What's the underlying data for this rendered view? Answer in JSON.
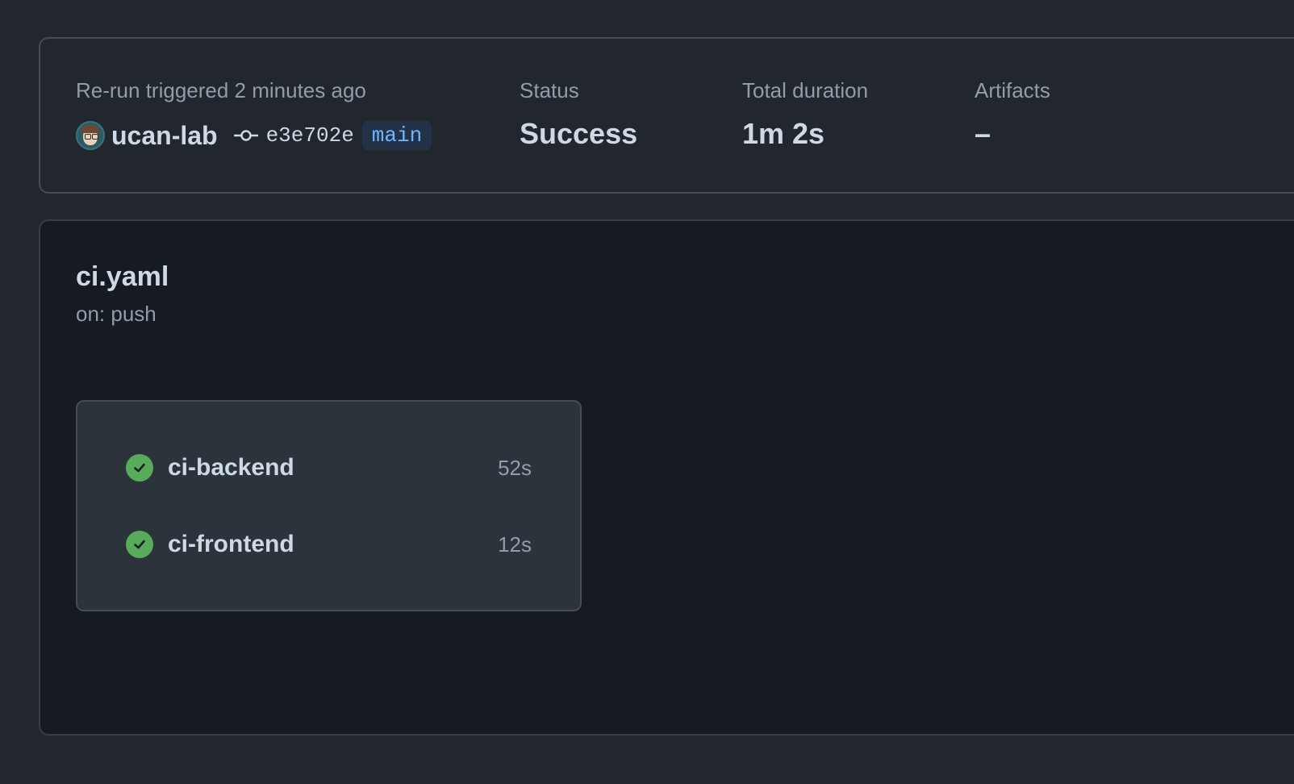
{
  "summary": {
    "trigger_label": "Re-run triggered 2 minutes ago",
    "actor": "ucan-lab",
    "commit_sha": "e3e702e",
    "branch": "main",
    "status_label": "Status",
    "status_value": "Success",
    "duration_label": "Total duration",
    "duration_value": "1m 2s",
    "artifacts_label": "Artifacts",
    "artifacts_value": "–"
  },
  "workflow": {
    "name": "ci.yaml",
    "trigger": "on: push",
    "jobs": [
      {
        "name": "ci-backend",
        "duration": "52s",
        "status": "success"
      },
      {
        "name": "ci-frontend",
        "duration": "12s",
        "status": "success"
      }
    ]
  },
  "colors": {
    "page_bg": "#22272e",
    "workflow_bg": "#161a21",
    "job_card_bg": "#2d333b",
    "success": "#57ab5a",
    "branch_text": "#6cb6ff",
    "branch_bg": "#243247"
  },
  "icons": {
    "commit": "git-commit-icon",
    "job_status": "check-circle-icon"
  }
}
